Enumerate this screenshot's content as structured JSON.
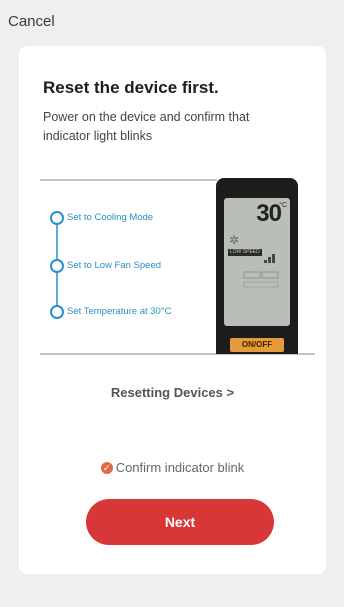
{
  "header": {
    "cancel_label": "Cancel"
  },
  "card": {
    "title": "Reset the device first.",
    "description": "Power on the device and confirm that indicator light blinks",
    "steps": [
      {
        "label": "Set to Cooling Mode"
      },
      {
        "label": "Set to Low Fan Speed"
      },
      {
        "label": "Set Temperature at 30°C"
      }
    ],
    "remote": {
      "temperature": "30",
      "unit": "°C",
      "badge": "LOW SPEED",
      "button_label": "ON/OFF"
    },
    "reset_link": "Resetting Devices >",
    "confirm_label": "Confirm indicator blink",
    "confirm_checked": true,
    "next_label": "Next"
  },
  "colors": {
    "accent": "#d73737",
    "step_blue": "#2a8fc9",
    "check": "#e06b45"
  }
}
